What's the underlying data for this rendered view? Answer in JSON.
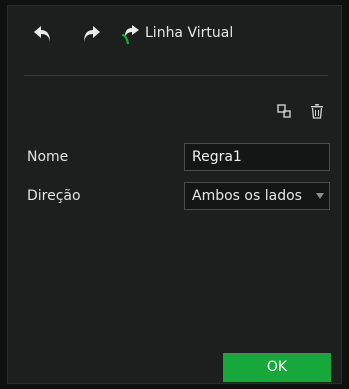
{
  "toolbar": {
    "title": "Linha Virtual",
    "icons": [
      "undo-arrow-icon",
      "redo-arrow-icon",
      "line-draw-icon"
    ]
  },
  "actions": {
    "icons": [
      "copy-icon",
      "trash-icon"
    ]
  },
  "form": {
    "name_label": "Nome",
    "name_value": "Regra1",
    "direction_label": "Direção",
    "direction_value": "Ambos os lados"
  },
  "buttons": {
    "ok_label": "OK"
  },
  "colors": {
    "background": "#1c1f1d",
    "accent_green": "#16a83a",
    "text": "#e6e6e6"
  }
}
